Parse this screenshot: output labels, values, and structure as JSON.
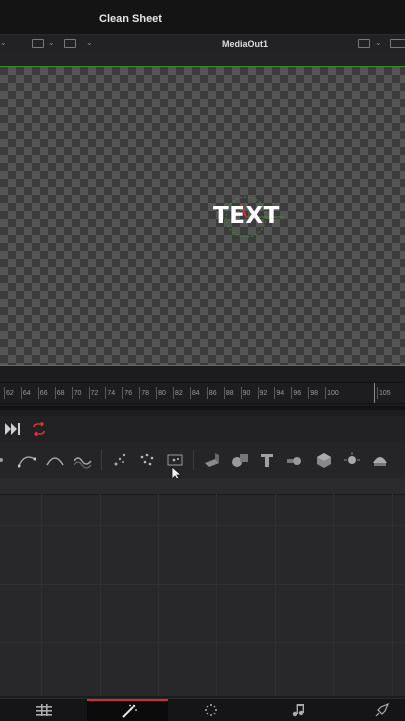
{
  "title_bar": {
    "title": "Clean Sheet"
  },
  "viewer": {
    "node_name": "MediaOut1",
    "overlay_text": "TEXT"
  },
  "ruler": {
    "labels": [
      "62",
      "64",
      "66",
      "68",
      "70",
      "72",
      "74",
      "76",
      "78",
      "80",
      "82",
      "84",
      "86",
      "88",
      "90",
      "92",
      "94",
      "96",
      "98",
      "100",
      "105"
    ]
  },
  "colors": {
    "accent_red": "#d32a3a",
    "frame_green": "#3b8b2a",
    "loop_red": "#e0303a"
  },
  "transport": {
    "icons": [
      "skip-to-end-icon",
      "loop-icon"
    ]
  },
  "toolbar": {
    "icons": [
      "curve-tool-icon",
      "bezier-tool-icon",
      "arc-tool-icon",
      "wave-tool-icon",
      "particle-emitter-icon",
      "particle-spray-icon",
      "particle-render-icon",
      "shape-3d-icon",
      "merge-3d-icon",
      "text-3d-icon",
      "camera-3d-icon",
      "renderer-3d-icon",
      "light-3d-icon",
      "spotlight-3d-icon"
    ]
  },
  "bottom_nav": {
    "items": [
      "edit-page-icon",
      "fusion-page-icon",
      "color-page-icon",
      "fairlight-page-icon",
      "deliver-page-icon"
    ],
    "active": "fusion-page-icon"
  }
}
